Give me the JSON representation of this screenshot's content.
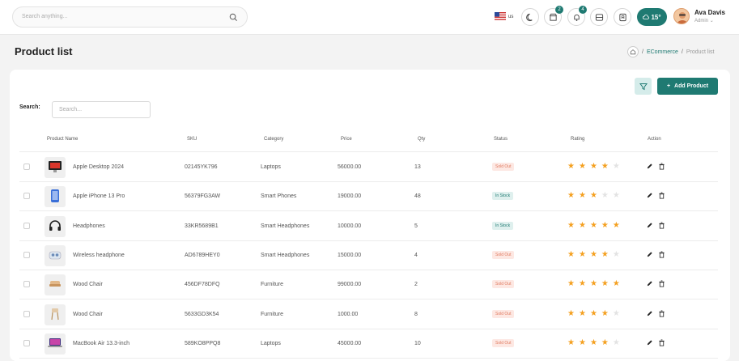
{
  "header": {
    "search_placeholder": "Search anything...",
    "language": "us",
    "cart_count": "2",
    "notif_count": "4",
    "weather": "15°",
    "user_name": "Ava Davis",
    "user_role": "Admin"
  },
  "page": {
    "title": "Product list",
    "breadcrumb_link": "ECommerce",
    "breadcrumb_current": "Product list",
    "breadcrumb_sep": "/"
  },
  "toolbar": {
    "add_label": "Add Product",
    "search_label": "Search:",
    "search_placeholder": "Search..."
  },
  "table": {
    "headers": [
      "Product Name",
      "SKU",
      "Category",
      "Price",
      "Qty",
      "Status",
      "Rating",
      "Action"
    ],
    "rows": [
      {
        "name": "Apple Desktop 2024",
        "sku": "02145YK796",
        "category": "Laptops",
        "price": "56000.00",
        "qty": "13",
        "status": "Sold Out",
        "rating": 4,
        "thumb": "desktop-icon"
      },
      {
        "name": "Apple iPhone 13 Pro",
        "sku": "56379FG3AW",
        "category": "Smart Phones",
        "price": "19000.00",
        "qty": "48",
        "status": "In Stock",
        "rating": 3,
        "thumb": "phone-icon"
      },
      {
        "name": "Headphones",
        "sku": "33KR5689B1",
        "category": "Smart Headphones",
        "price": "10000.00",
        "qty": "5",
        "status": "In Stock",
        "rating": 5,
        "thumb": "headphones-icon"
      },
      {
        "name": "Wireless headphone",
        "sku": "AD6789HEY0",
        "category": "Smart Headphones",
        "price": "15000.00",
        "qty": "4",
        "status": "Sold Out",
        "rating": 4,
        "thumb": "earbuds-icon"
      },
      {
        "name": "Wood Chair",
        "sku": "456DF78DFQ",
        "category": "Furniture",
        "price": "99000.00",
        "qty": "2",
        "status": "Sold Out",
        "rating": 5,
        "thumb": "chair-icon"
      },
      {
        "name": "Wood Chair",
        "sku": "5633GD3K54",
        "category": "Furniture",
        "price": "1000.00",
        "qty": "8",
        "status": "Sold Out",
        "rating": 4,
        "thumb": "stool-icon"
      },
      {
        "name": "MacBook Air 13.3-inch",
        "sku": "589KO8PPQ8",
        "category": "Laptops",
        "price": "45000.00",
        "qty": "10",
        "status": "Sold Out",
        "rating": 4,
        "thumb": "laptop-icon"
      }
    ]
  },
  "colors": {
    "accent": "#1f7a72",
    "star": "#f4a020",
    "sold_out": "#e07a5f"
  }
}
